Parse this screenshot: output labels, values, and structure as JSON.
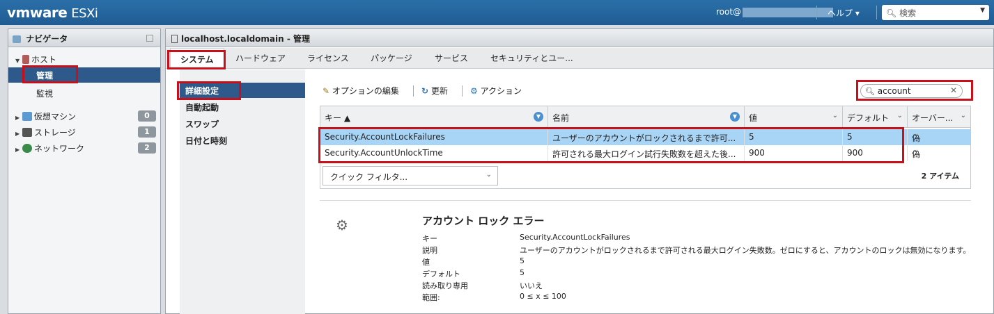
{
  "topbar": {
    "logo_vm": "vmware",
    "logo_product": "ESXi",
    "user": "root@",
    "help": "ヘルプ ▾",
    "search_placeholder": "検索"
  },
  "navigator": {
    "title": "ナビゲータ",
    "host": "ホスト",
    "host_children": [
      "管理",
      "監視"
    ],
    "items": [
      {
        "label": "仮想マシン",
        "count": "0"
      },
      {
        "label": "ストレージ",
        "count": "1"
      },
      {
        "label": "ネットワーク",
        "count": "2"
      }
    ]
  },
  "main": {
    "title": "localhost.localdomain - 管理",
    "tabs": [
      "システム",
      "ハードウェア",
      "ライセンス",
      "パッケージ",
      "サービス",
      "セキュリティとユー..."
    ],
    "subnav": [
      "詳細設定",
      "自動起動",
      "スワップ",
      "日付と時刻"
    ],
    "toolbar": {
      "edit": "オプションの編集",
      "refresh": "更新",
      "action": "アクション"
    },
    "filter_value": "account",
    "grid": {
      "columns": [
        "キー ▲",
        "名前",
        "値",
        "デフォルト",
        "オーバー..."
      ],
      "rows": [
        [
          "Security.AccountLockFailures",
          "ユーザーのアカウントがロックされるまで許可...",
          "5",
          "5",
          "偽"
        ],
        [
          "Security.AccountUnlockTime",
          "許可される最大ログイン試行失敗数を超えた後...",
          "900",
          "900",
          "偽"
        ]
      ],
      "quick_filter": "クイック フィルタ...",
      "item_count": "2 アイテム"
    },
    "detail": {
      "title": "アカウント ロック エラー",
      "fields": [
        {
          "label": "キー",
          "value": "Security.AccountLockFailures"
        },
        {
          "label": "説明",
          "value": "ユーザーのアカウントがロックされるまで許可される最大ログイン失敗数。ゼロにすると、アカウントのロックは無効になります。"
        },
        {
          "label": "値",
          "value": "5"
        },
        {
          "label": "デフォルト",
          "value": "5"
        },
        {
          "label": "読み取り専用",
          "value": "いいえ"
        },
        {
          "label": "範囲:",
          "value": "0 ≤ x ≤ 100"
        }
      ]
    }
  },
  "colors": {
    "topbar": "#1f5c93",
    "selected": "#2d5a8a",
    "row_selected": "#a8d4f5",
    "highlight": "#c8101a"
  }
}
